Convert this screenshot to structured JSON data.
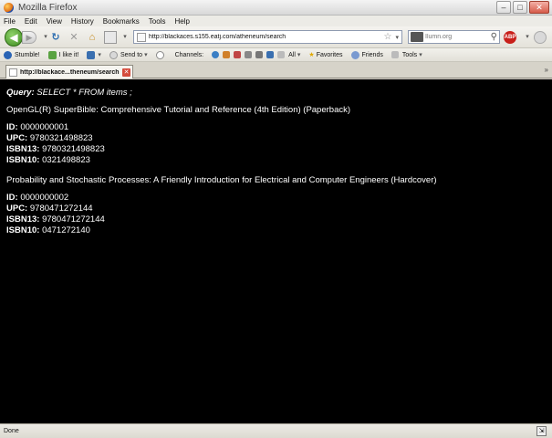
{
  "window": {
    "title": "Mozilla Firefox"
  },
  "menu": {
    "items": [
      "File",
      "Edit",
      "View",
      "History",
      "Bookmarks",
      "Tools",
      "Help"
    ]
  },
  "navbar": {
    "url": "http://blackaces.s155.eatj.com/atheneum/search",
    "search_placeholder": "Ilumn.org"
  },
  "stumblebar": {
    "stumble": "Stumble!",
    "like": "I like it!",
    "send_to": "Send to",
    "channels": "Channels:",
    "all": "All",
    "favorites": "Favorites",
    "friends": "Friends",
    "tools": "Tools"
  },
  "tab": {
    "label": "http://blackace...theneum/search"
  },
  "page": {
    "query_label": "Query:",
    "query_text": "SELECT * FROM items ;",
    "items": [
      {
        "title": "OpenGL(R) SuperBible: Comprehensive Tutorial and Reference (4th Edition) (Paperback)",
        "id_label": "ID:",
        "id": "0000000001",
        "upc_label": "UPC:",
        "upc": "9780321498823",
        "isbn13_label": "ISBN13:",
        "isbn13": "9780321498823",
        "isbn10_label": "ISBN10:",
        "isbn10": "0321498823"
      },
      {
        "title": "Probability and Stochastic Processes: A Friendly Introduction for Electrical and Computer Engineers (Hardcover)",
        "id_label": "ID:",
        "id": "0000000002",
        "upc_label": "UPC:",
        "upc": "9780471272144",
        "isbn13_label": "ISBN13:",
        "isbn13": "9780471272144",
        "isbn10_label": "ISBN10:",
        "isbn10": "0471272140"
      }
    ]
  },
  "status": {
    "text": "Done"
  }
}
